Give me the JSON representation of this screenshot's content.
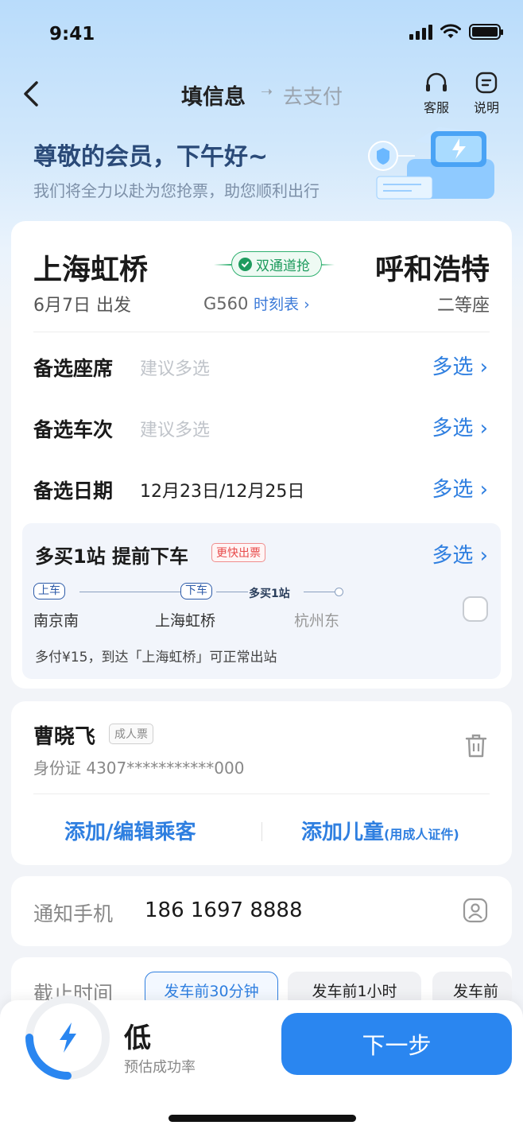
{
  "status_bar": {
    "time": "9:41"
  },
  "nav": {
    "title": "填信息",
    "next_step": "去支付",
    "service_label": "客服",
    "info_label": "说明"
  },
  "greeting": {
    "title": "尊敬的会员，下午好~",
    "subtitle": "我们将全力以赴为您抢票，助您顺利出行"
  },
  "trip": {
    "from": "上海虹桥",
    "to": "呼和浩特",
    "depart": "6月7日 出发",
    "badge": "双通道抢",
    "train": "G560",
    "timetable": "时刻表",
    "seat": "二等座"
  },
  "options": {
    "seat_label": "备选座席",
    "seat_hint": "建议多选",
    "train_label": "备选车次",
    "train_hint": "建议多选",
    "date_label": "备选日期",
    "date_value": "12月23日/12月25日",
    "more": "多选"
  },
  "extra_stop": {
    "title": "多买1站 提前下车",
    "tag": "更快出票",
    "more": "多选",
    "board_tag": "上车",
    "alight_tag": "下车",
    "plus_text": "多买1站",
    "board_station": "南京南",
    "alight_station": "上海虹桥",
    "end_station": "杭州东",
    "note": "多付¥15，到达「上海虹桥」可正常出站",
    "checked": false
  },
  "passenger": {
    "name": "曹晓飞",
    "type": "成人票",
    "id": "身份证 4307***********000",
    "add_label": "添加/编辑乘客",
    "add_child_label": "添加儿童",
    "add_child_note": "(用成人证件)"
  },
  "contact": {
    "label": "通知手机",
    "phone": "186 1697 8888"
  },
  "deadline": {
    "label": "截止时间",
    "options": [
      "发车前30分钟",
      "发车前1小时",
      "发车前"
    ],
    "selected": 0
  },
  "footer": {
    "rate_value": "低",
    "rate_label": "预估成功率",
    "next_label": "下一步"
  },
  "colors": {
    "accent": "#2f7fe0",
    "primary_button": "#2a86f0",
    "green": "#1e9b5e",
    "red": "#e84a4a"
  }
}
